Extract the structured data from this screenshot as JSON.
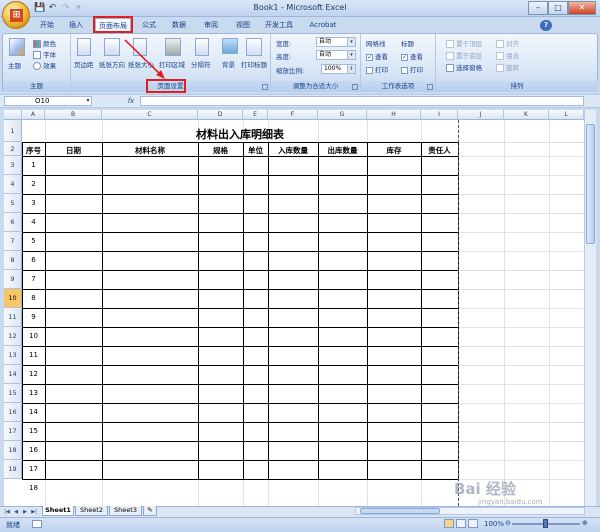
{
  "window": {
    "title": "Book1 - Microsoft Excel",
    "min": "–",
    "max": "□",
    "close": "✕"
  },
  "qat": {
    "save": "💾",
    "undo": "↶",
    "redo": "↷",
    "more": "▾"
  },
  "tabs": [
    "开始",
    "插入",
    "页面布局",
    "公式",
    "数据",
    "审阅",
    "视图",
    "开发工具",
    "Acrobat"
  ],
  "active_tab": "页面布局",
  "help": "?",
  "ribbon": {
    "theme": {
      "btn": "主题",
      "colors": "颜色",
      "fonts": "字体",
      "effects": "效果",
      "label": "主题"
    },
    "setup": {
      "margins": "页边距",
      "orientation": "纸张方向",
      "size": "纸张大小",
      "print_area": "打印区域",
      "breaks": "分隔符",
      "background": "背景",
      "titles": "打印标题",
      "label": "页面设置"
    },
    "scale": {
      "width": "宽度:",
      "height": "高度:",
      "scale": "缩放比例:",
      "width_val": "自动",
      "height_val": "自动",
      "scale_val": "100%",
      "label": "调整为合适大小"
    },
    "sheet_opts": {
      "gridlines": "网格线",
      "headings": "标题",
      "view": "查看",
      "print": "打印",
      "label": "工作表选项"
    },
    "arrange": {
      "front": "置于顶层",
      "back": "置于底层",
      "pane": "选择窗格",
      "align": "对齐",
      "group": "组合",
      "rotate": "旋转",
      "label": "排列"
    }
  },
  "formula_bar": {
    "namebox": "O10",
    "fx": "fx",
    "value": ""
  },
  "columns": [
    "A",
    "B",
    "C",
    "D",
    "E",
    "F",
    "G",
    "H",
    "I",
    "J",
    "K",
    "L"
  ],
  "row_numbers": [
    "1",
    "2",
    "3",
    "4",
    "5",
    "6",
    "7",
    "8",
    "9",
    "10",
    "11",
    "12",
    "13",
    "14",
    "15",
    "16",
    "17",
    "18",
    "19"
  ],
  "table": {
    "title": "材料出入库明细表",
    "headers": [
      "序号",
      "日期",
      "材料名称",
      "规格",
      "单位",
      "入库数量",
      "出库数量",
      "库存",
      "责任人"
    ],
    "serials": [
      "1",
      "2",
      "3",
      "4",
      "5",
      "6",
      "7",
      "8",
      "9",
      "10",
      "11",
      "12",
      "13",
      "14",
      "15",
      "16",
      "17",
      "18"
    ]
  },
  "sheets": [
    "Sheet1",
    "Sheet2",
    "Sheet3"
  ],
  "status": {
    "ready": "就绪",
    "zoom": "100%"
  },
  "watermark": {
    "main": "Bai 经验",
    "sub": "jingyan.baidu.com"
  },
  "colors": {
    "highlight": "#e02020",
    "accent": "#15428b"
  }
}
